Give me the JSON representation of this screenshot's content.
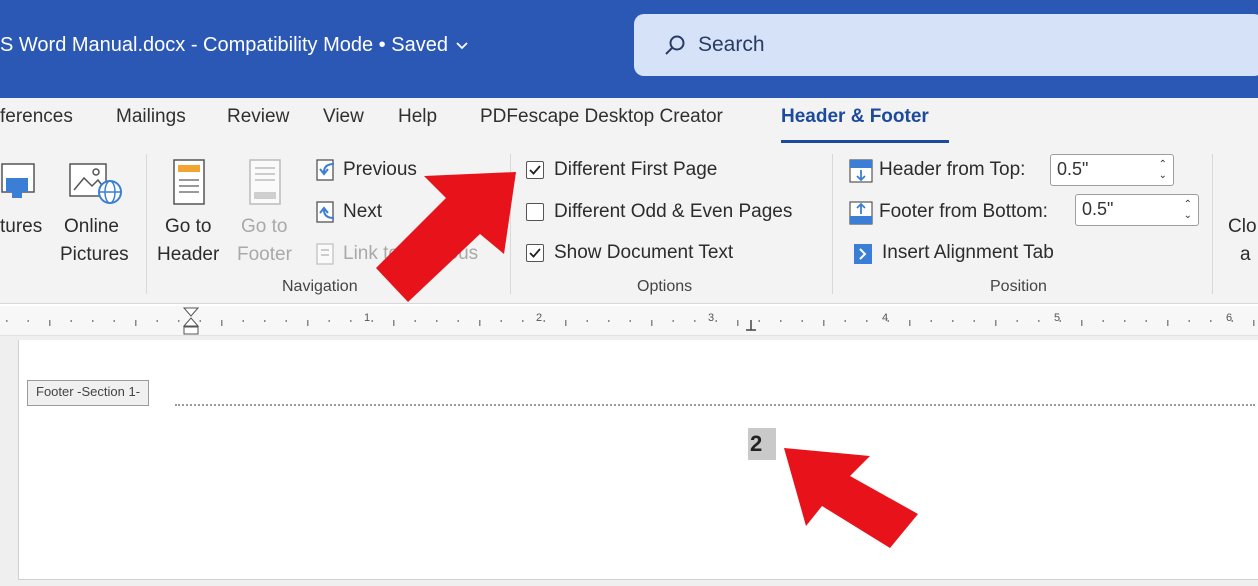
{
  "title_bar": {
    "document_title": "S Word Manual.docx  -  Compatibility Mode • Saved",
    "search_placeholder": "Search"
  },
  "tabs": [
    "ferences",
    "Mailings",
    "Review",
    "View",
    "Help",
    "PDFescape Desktop Creator",
    "Header & Footer"
  ],
  "active_tab": "Header & Footer",
  "ribbon": {
    "insert_group": {
      "pictures_label": "tures",
      "online_pictures_label_1": "Online",
      "online_pictures_label_2": "Pictures"
    },
    "navigation": {
      "go_to_header_1": "Go to",
      "go_to_header_2": "Header",
      "go_to_footer_1": "Go to",
      "go_to_footer_2": "Footer",
      "previous": "Previous",
      "next": "Next",
      "link_to_previous": "Link to Previous",
      "group_label": "Navigation"
    },
    "options": {
      "different_first_page": "Different First Page",
      "different_first_page_checked": true,
      "different_odd_even": "Different Odd & Even Pages",
      "different_odd_even_checked": false,
      "show_document_text": "Show Document Text",
      "show_document_text_checked": true,
      "group_label": "Options"
    },
    "position": {
      "header_from_top_label": "Header from Top:",
      "header_from_top_value": "0.5\"",
      "footer_from_bottom_label": "Footer from Bottom:",
      "footer_from_bottom_value": "0.5\"",
      "insert_alignment_tab": "Insert Alignment Tab",
      "group_label": "Position"
    },
    "close": {
      "label_1": "Clo",
      "label_2": "a"
    }
  },
  "ruler": {
    "numbers": [
      "1",
      "2",
      "3",
      "4",
      "5",
      "6"
    ]
  },
  "document": {
    "footer_tag": "Footer -Section 1-",
    "page_number": "2"
  },
  "colors": {
    "title_bar": "#2b58b5",
    "accent": "#1c4a9c",
    "arrow": "#e8121a",
    "icon_blue": "#3a7fd5"
  }
}
